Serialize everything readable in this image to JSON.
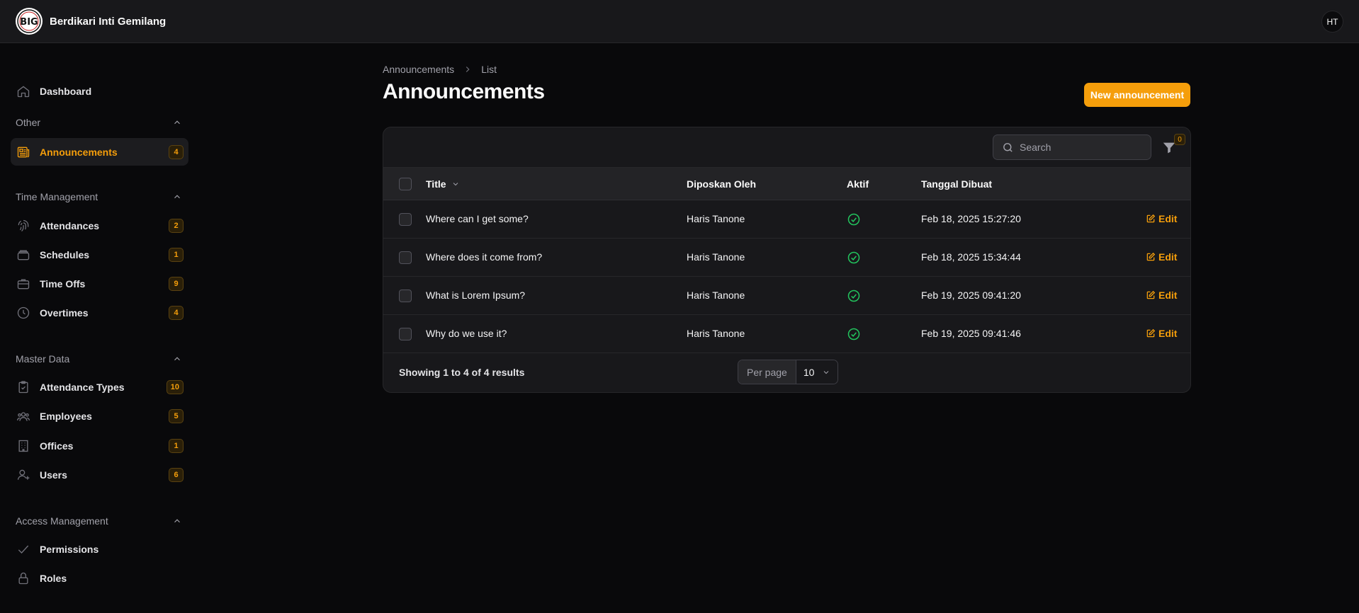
{
  "app": {
    "brand": "Berdikari Inti Gemilang",
    "user_initials": "HT",
    "accent": "#f59e0b"
  },
  "sidebar": {
    "dashboard": {
      "label": "Dashboard",
      "icon": "home-icon"
    },
    "groups": [
      {
        "label": "Other",
        "items": [
          {
            "label": "Announcements",
            "badge": "4",
            "icon": "newspaper-icon",
            "active": true
          }
        ]
      },
      {
        "label": "Time Management",
        "items": [
          {
            "label": "Attendances",
            "badge": "2",
            "icon": "fingerprint-icon"
          },
          {
            "label": "Schedules",
            "badge": "1",
            "icon": "stack-icon"
          },
          {
            "label": "Time Offs",
            "badge": "9",
            "icon": "briefcase-icon"
          },
          {
            "label": "Overtimes",
            "badge": "4",
            "icon": "clock-icon"
          }
        ]
      },
      {
        "label": "Master Data",
        "items": [
          {
            "label": "Attendance Types",
            "badge": "10",
            "icon": "clipboard-check-icon"
          },
          {
            "label": "Employees",
            "badge": "5",
            "icon": "users-group-icon"
          },
          {
            "label": "Offices",
            "badge": "1",
            "icon": "building-icon"
          },
          {
            "label": "Users",
            "badge": "6",
            "icon": "user-plus-icon"
          }
        ]
      },
      {
        "label": "Access Management",
        "items": [
          {
            "label": "Permissions",
            "icon": "check-icon"
          },
          {
            "label": "Roles",
            "icon": "lock-icon"
          }
        ]
      }
    ]
  },
  "breadcrumb": [
    "Announcements",
    "List"
  ],
  "page": {
    "title": "Announcements",
    "new_button": "New announcement"
  },
  "table": {
    "search_placeholder": "Search",
    "filter_count": "0",
    "columns": {
      "title": "Title",
      "posted_by": "Diposkan Oleh",
      "active": "Aktif",
      "created": "Tanggal Dibuat"
    },
    "rows": [
      {
        "title": "Where can I get some?",
        "posted_by": "Haris Tanone",
        "active": true,
        "created": "Feb 18, 2025 15:27:20",
        "action": "Edit"
      },
      {
        "title": "Where does it come from?",
        "posted_by": "Haris Tanone",
        "active": true,
        "created": "Feb 18, 2025 15:34:44",
        "action": "Edit"
      },
      {
        "title": "What is Lorem Ipsum?",
        "posted_by": "Haris Tanone",
        "active": true,
        "created": "Feb 19, 2025 09:41:20",
        "action": "Edit"
      },
      {
        "title": "Why do we use it?",
        "posted_by": "Haris Tanone",
        "active": true,
        "created": "Feb 19, 2025 09:41:46",
        "action": "Edit"
      }
    ],
    "summary": "Showing 1 to 4 of 4 results",
    "per_page_label": "Per page",
    "per_page_value": "10"
  }
}
